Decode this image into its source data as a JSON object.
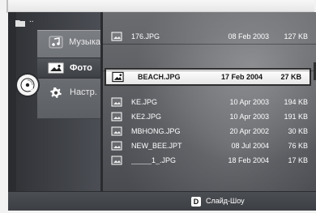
{
  "sidebar": {
    "items": [
      {
        "label": "Музыка",
        "icon": "music-note-icon"
      },
      {
        "label": "Фото",
        "icon": "photo-icon"
      },
      {
        "label": "Настр.",
        "icon": "settings-icon"
      }
    ],
    "disc_label": "CD"
  },
  "file_list": {
    "up_label": "..",
    "files": [
      {
        "name": "176.JPG",
        "date": "08 Feb 2003",
        "size": "127 KB"
      },
      {
        "name": "BEACH.JPG",
        "date": "17 Feb 2004",
        "size": "27 KB"
      },
      {
        "name": "KE.JPG",
        "date": "10 Apr 2003",
        "size": "194 KB"
      },
      {
        "name": "KE2.JPG",
        "date": "10 Apr 2003",
        "size": "191 KB"
      },
      {
        "name": "MBHONG.JPG",
        "date": "20 Apr 2002",
        "size": "30 KB"
      },
      {
        "name": "NEW_BEE.JPT",
        "date": "08 Jul 2004",
        "size": "76 KB"
      },
      {
        "name": "_____1_.JPG",
        "date": "18 Feb 2004",
        "size": "17 KB"
      }
    ],
    "selected_index": 1
  },
  "footer": {
    "button_key": "D",
    "button_label": "Слайд-Шоу"
  },
  "colors": {
    "panel": "#3c3f44",
    "highlight": "#ffffff",
    "text": "#ffffff"
  }
}
